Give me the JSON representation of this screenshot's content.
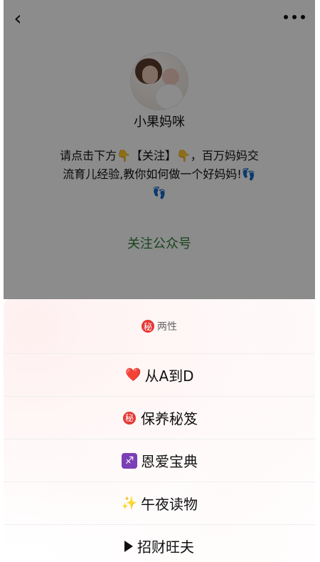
{
  "top": {
    "back_icon": "chevron-left-icon",
    "more_icon": "more-horizontal-icon",
    "profile_name": "小果妈咪",
    "description": "请点击下方👇【关注】👇，百万妈妈交\n流育儿经验,教你如何做一个好妈妈!👣\n👣",
    "follow_label": "关注公众号",
    "follow_color": "#2e7d32"
  },
  "sheet": {
    "header_badge": "秘",
    "header_text": "两性",
    "items": [
      {
        "icon": "❤️",
        "icon_name": "heart-icon",
        "label": "从A到D"
      },
      {
        "icon": "秘",
        "icon_name": "secret-badge-icon",
        "label": "保养秘笈"
      },
      {
        "icon": "♐",
        "icon_name": "sagittarius-icon",
        "label": "恩爱宝典"
      },
      {
        "icon": "✨",
        "icon_name": "sparkles-icon",
        "label": "午夜读物"
      },
      {
        "icon": "▶",
        "icon_name": "play-icon",
        "label": "招财旺夫"
      }
    ]
  }
}
